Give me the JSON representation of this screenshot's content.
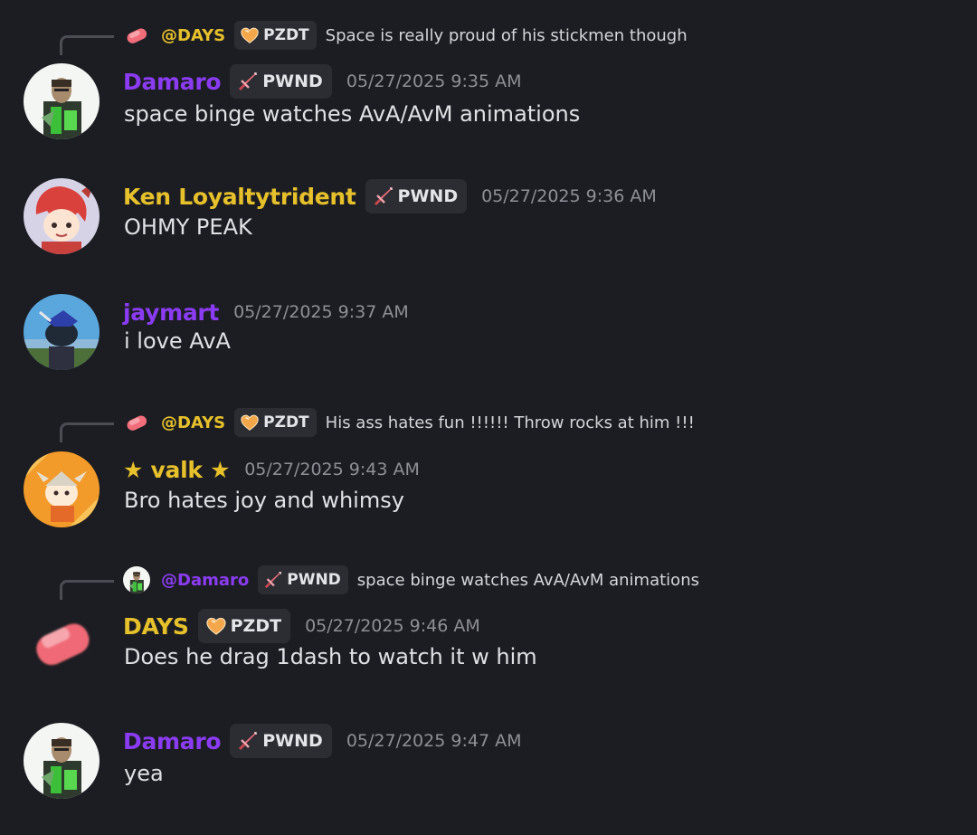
{
  "colors": {
    "background": "#1c1d22",
    "purple_role": "#8b3cf2",
    "gold_role": "#e7c12b",
    "timestamp": "#8d9096"
  },
  "messages": [
    {
      "reply": {
        "mention": "@DAYS",
        "tag": "PZDT",
        "tag_icon": "heart-badge-icon",
        "text": "Space is really proud of his stickmen though"
      },
      "author": "Damaro",
      "tag": "PWND",
      "tag_icon": "sword-badge-icon",
      "timestamp": "05/27/2025 9:35 AM",
      "content": "space binge watches AvA/AvM animations"
    },
    {
      "author": "Ken Loyaltytrident",
      "tag": "PWND",
      "tag_icon": "sword-badge-icon",
      "timestamp": "05/27/2025 9:36 AM",
      "content": "OHMY PEAK"
    },
    {
      "author": "jaymart",
      "timestamp": "05/27/2025 9:37 AM",
      "content": "i love AvA"
    },
    {
      "reply": {
        "mention": "@DAYS",
        "tag": "PZDT",
        "tag_icon": "heart-badge-icon",
        "text": "His ass hates fun !!!!!! Throw rocks at him !!!"
      },
      "author": "★ valk ★",
      "timestamp": "05/27/2025 9:43 AM",
      "content": "Bro hates joy and whimsy"
    },
    {
      "reply": {
        "mention": "@Damaro",
        "tag": "PWND",
        "tag_icon": "sword-badge-icon",
        "text": "space binge watches AvA/AvM animations"
      },
      "author": "DAYS",
      "tag": "PZDT",
      "tag_icon": "heart-badge-icon",
      "timestamp": "05/27/2025 9:46 AM",
      "content": "Does he drag 1dash to watch it w him"
    },
    {
      "author": "Damaro",
      "tag": "PWND",
      "tag_icon": "sword-badge-icon",
      "timestamp": "05/27/2025 9:47 AM",
      "content": "yea"
    }
  ]
}
